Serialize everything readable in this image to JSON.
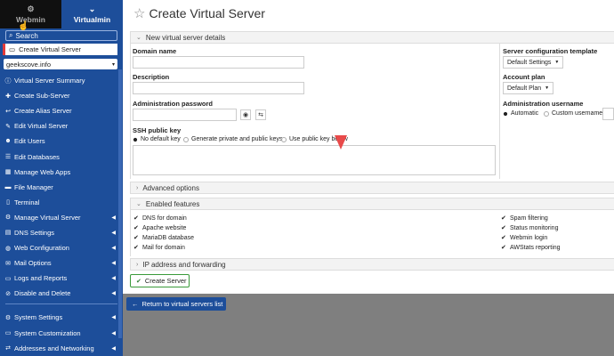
{
  "sidebar": {
    "tabs": [
      {
        "label": "Webmin",
        "icon": "gauge-icon"
      },
      {
        "label": "Virtualmin",
        "icon": "chevron-down-icon"
      }
    ],
    "search_label": "Search",
    "create_label": "Create Virtual Server",
    "domain_value": "geekscove.info",
    "items": [
      {
        "label": "Virtual Server Summary",
        "icon": "info-icon",
        "arrow": false
      },
      {
        "label": "Create Sub-Server",
        "icon": "plus-icon",
        "arrow": false
      },
      {
        "label": "Create Alias Server",
        "icon": "return-icon",
        "arrow": false
      },
      {
        "label": "Edit Virtual Server",
        "icon": "edit-icon",
        "arrow": false
      },
      {
        "label": "Edit Users",
        "icon": "users-icon",
        "arrow": false
      },
      {
        "label": "Edit Databases",
        "icon": "database-icon",
        "arrow": false
      },
      {
        "label": "Manage Web Apps",
        "icon": "cubes-icon",
        "arrow": false
      },
      {
        "label": "File Manager",
        "icon": "folder-icon",
        "arrow": false
      },
      {
        "label": "Terminal",
        "icon": "terminal-icon",
        "arrow": false
      },
      {
        "label": "Manage Virtual Server",
        "icon": "gears-icon",
        "arrow": true
      },
      {
        "label": "DNS Settings",
        "icon": "dns-icon",
        "arrow": true
      },
      {
        "label": "Web Configuration",
        "icon": "globe-icon",
        "arrow": true
      },
      {
        "label": "Mail Options",
        "icon": "envelope-icon",
        "arrow": true
      },
      {
        "label": "Logs and Reports",
        "icon": "document-icon",
        "arrow": true
      },
      {
        "label": "Disable and Delete",
        "icon": "ban-icon",
        "arrow": true
      }
    ],
    "bottom_items": [
      {
        "label": "System Settings",
        "icon": "cog-icon",
        "arrow": true
      },
      {
        "label": "System Customization",
        "icon": "desktop-icon",
        "arrow": true
      },
      {
        "label": "Addresses and Networking",
        "icon": "network-icon",
        "arrow": true
      }
    ]
  },
  "main": {
    "title": "Create Virtual Server",
    "sections": {
      "details": "New virtual server details",
      "advanced": "Advanced options",
      "features": "Enabled features",
      "ip": "IP address and forwarding"
    },
    "fields": {
      "domain_label": "Domain name",
      "description_label": "Description",
      "password_label": "Administration password",
      "ssh_label": "SSH public key",
      "ssh_options": [
        "No default key",
        "Generate private and public keys",
        "Use public key below"
      ],
      "template_label": "Server configuration template",
      "template_value": "Default Settings",
      "plan_label": "Account plan",
      "plan_value": "Default Plan",
      "admin_user_label": "Administration username",
      "admin_user_options": [
        "Automatic",
        "Custom username"
      ]
    },
    "features_left": [
      "DNS for domain",
      "Apache website",
      "MariaDB database",
      "Mail for domain"
    ],
    "features_right": [
      "Spam filtering",
      "Status monitoring",
      "Webmin login",
      "AWStats reporting"
    ],
    "create_button": "Create Server",
    "return_button": "Return to virtual servers list"
  }
}
